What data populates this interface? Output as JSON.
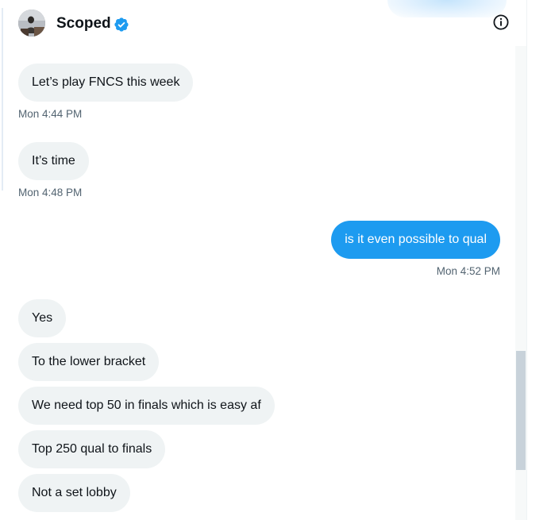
{
  "header": {
    "display_name": "Scoped",
    "verified": true,
    "info_icon": "info-circle-icon"
  },
  "colors": {
    "incoming_bubble": "#eff3f4",
    "outgoing_bubble": "#1d9bf0",
    "timestamp": "#536471",
    "verified_badge": "#1d9bf0"
  },
  "messages": [
    {
      "direction": "incoming",
      "text": "Let’s play FNCS this week",
      "timestamp": "Mon 4:44 PM"
    },
    {
      "direction": "incoming",
      "text": "It’s time",
      "timestamp": "Mon 4:48 PM"
    },
    {
      "direction": "outgoing",
      "text": "is it even possible to qual",
      "timestamp": "Mon 4:52 PM"
    },
    {
      "direction": "incoming",
      "text": "Yes"
    },
    {
      "direction": "incoming",
      "text": "To the lower bracket"
    },
    {
      "direction": "incoming",
      "text": "We need top 50 in finals which is easy af"
    },
    {
      "direction": "incoming",
      "text": "Top 250 qual to finals"
    },
    {
      "direction": "incoming",
      "text": "Not a set lobby"
    }
  ]
}
